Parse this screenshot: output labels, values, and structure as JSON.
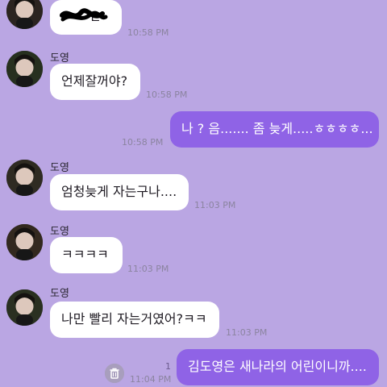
{
  "chat": {
    "messages": [
      {
        "type": "incoming",
        "sender": "",
        "text": "ㄷ",
        "time": "10:58 PM"
      },
      {
        "type": "incoming",
        "sender": "도영",
        "text": "언제잘꺼야?",
        "time": "10:58 PM"
      },
      {
        "type": "outgoing",
        "text": "나 ? 음....... 좀 늦게.....ㅎㅎㅎㅎ...",
        "time": "10:58 PM"
      },
      {
        "type": "incoming",
        "sender": "도영",
        "text": "엄청늦게 자는구나....",
        "time": "11:03 PM"
      },
      {
        "type": "incoming",
        "sender": "도영",
        "text": "ㅋㅋㅋㅋ",
        "time": "11:03 PM"
      },
      {
        "type": "incoming",
        "sender": "도영",
        "text": "나만 빨리 자는거였어?ㅋㅋ",
        "time": "11:03 PM"
      },
      {
        "type": "outgoing",
        "text": "김도영은 새나라의 어린이니까....",
        "time": "11:04 PM",
        "unread": "1"
      }
    ]
  },
  "colors": {
    "background": "#baa6e3",
    "incoming_bubble": "#ffffff",
    "outgoing_bubble": "#8f63e6",
    "timestamp": "#8b84a0"
  },
  "icons": {
    "avatar": "profile-photo",
    "delete": "trash-icon"
  }
}
